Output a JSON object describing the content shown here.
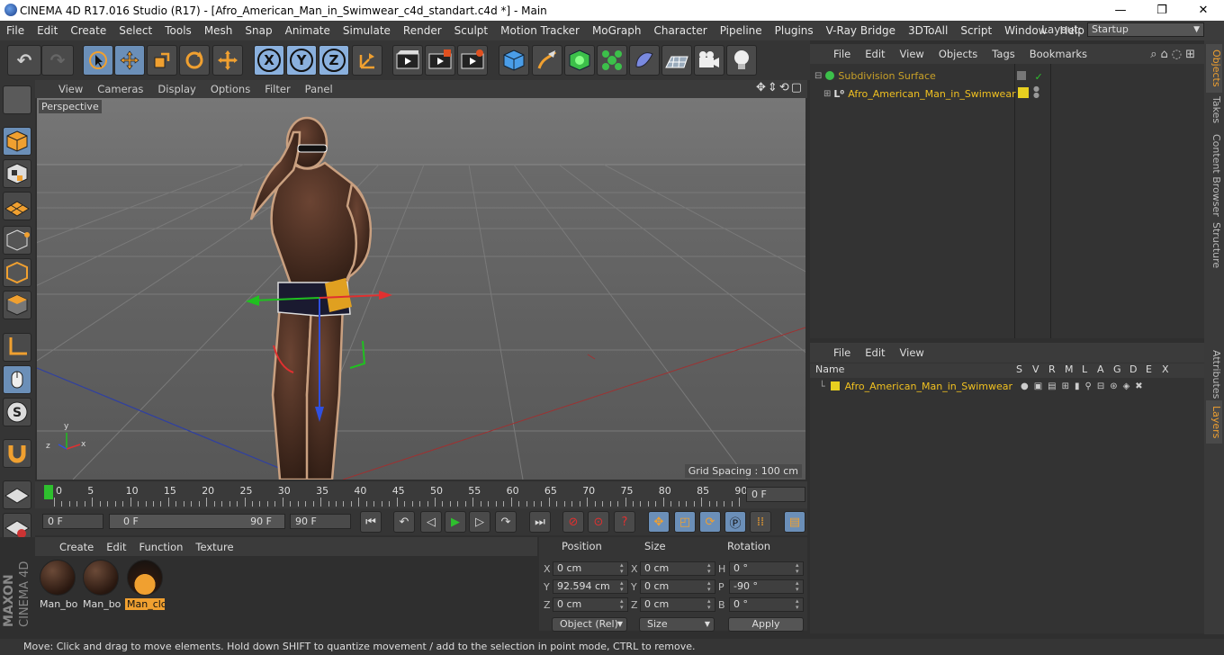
{
  "window": {
    "title": "CINEMA 4D R17.016 Studio (R17) - [Afro_American_Man_in_Swimwear_c4d_standart.c4d *] - Main",
    "controls": [
      "—",
      "❐",
      "✕"
    ]
  },
  "menu": [
    "File",
    "Edit",
    "Create",
    "Select",
    "Tools",
    "Mesh",
    "Snap",
    "Animate",
    "Simulate",
    "Render",
    "Sculpt",
    "Motion Tracker",
    "MoGraph",
    "Character",
    "Pipeline",
    "Plugins",
    "V-Ray Bridge",
    "3DToAll",
    "Script",
    "Window",
    "Help"
  ],
  "layout": {
    "label": "Layout:",
    "value": "Startup"
  },
  "toolbar": {
    "x": "X",
    "y": "Y",
    "z": "Z"
  },
  "viewport": {
    "menu": [
      "View",
      "Cameras",
      "Display",
      "Options",
      "Filter",
      "Panel"
    ],
    "label": "Perspective",
    "grid_spacing": "Grid Spacing : 100 cm",
    "axis_y": "y",
    "axis_z": "z",
    "axis_x": "x"
  },
  "timeline": {
    "ticks": [
      "0",
      "5",
      "10",
      "15",
      "20",
      "25",
      "30",
      "35",
      "40",
      "45",
      "50",
      "55",
      "60",
      "65",
      "70",
      "75",
      "80",
      "85",
      "90"
    ],
    "current": "0 F",
    "start": "0 F",
    "range_start": "0 F",
    "range_end": "90 F",
    "end": "90 F"
  },
  "materials": {
    "menu": [
      "Create",
      "Edit",
      "Function",
      "Texture"
    ],
    "items": [
      "Man_bo",
      "Man_bo",
      "Man_clc"
    ]
  },
  "coords": {
    "headers": {
      "position": "Position",
      "size": "Size",
      "rotation": "Rotation"
    },
    "rows": [
      {
        "axis": "X",
        "pos": "0 cm",
        "saxis": "X",
        "size": "0 cm",
        "raxis": "H",
        "rot": "0 °"
      },
      {
        "axis": "Y",
        "pos": "92.594 cm",
        "saxis": "Y",
        "size": "0 cm",
        "raxis": "P",
        "rot": "-90 °"
      },
      {
        "axis": "Z",
        "pos": "0 cm",
        "saxis": "Z",
        "size": "0 cm",
        "raxis": "B",
        "rot": "0 °"
      }
    ],
    "mode": "Object (Rel)",
    "size_mode": "Size",
    "apply": "Apply"
  },
  "objects": {
    "menu": [
      "File",
      "Edit",
      "View",
      "Objects",
      "Tags",
      "Bookmarks"
    ],
    "items": [
      {
        "name": "Subdivision Surface",
        "color": "#c8a028"
      },
      {
        "name": "Afro_American_Man_in_Swimwear",
        "color": "#f0c020"
      }
    ]
  },
  "layers": {
    "menu": [
      "File",
      "Edit",
      "View"
    ],
    "name_header": "Name",
    "columns": [
      "S",
      "V",
      "R",
      "M",
      "L",
      "A",
      "G",
      "D",
      "E",
      "X"
    ],
    "row": "Afro_American_Man_in_Swimwear"
  },
  "side_tabs": [
    "Objects",
    "Takes",
    "Content Browser",
    "Structure",
    "Attributes",
    "Layers"
  ],
  "status": "Move: Click and drag to move elements. Hold down SHIFT to quantize movement / add to the selection in point mode, CTRL to remove.",
  "brand": {
    "maxon": "MAXON",
    "product": "CINEMA 4D"
  },
  "colors": {
    "accent": "#f0a030",
    "selection": "#6b8fb8"
  }
}
